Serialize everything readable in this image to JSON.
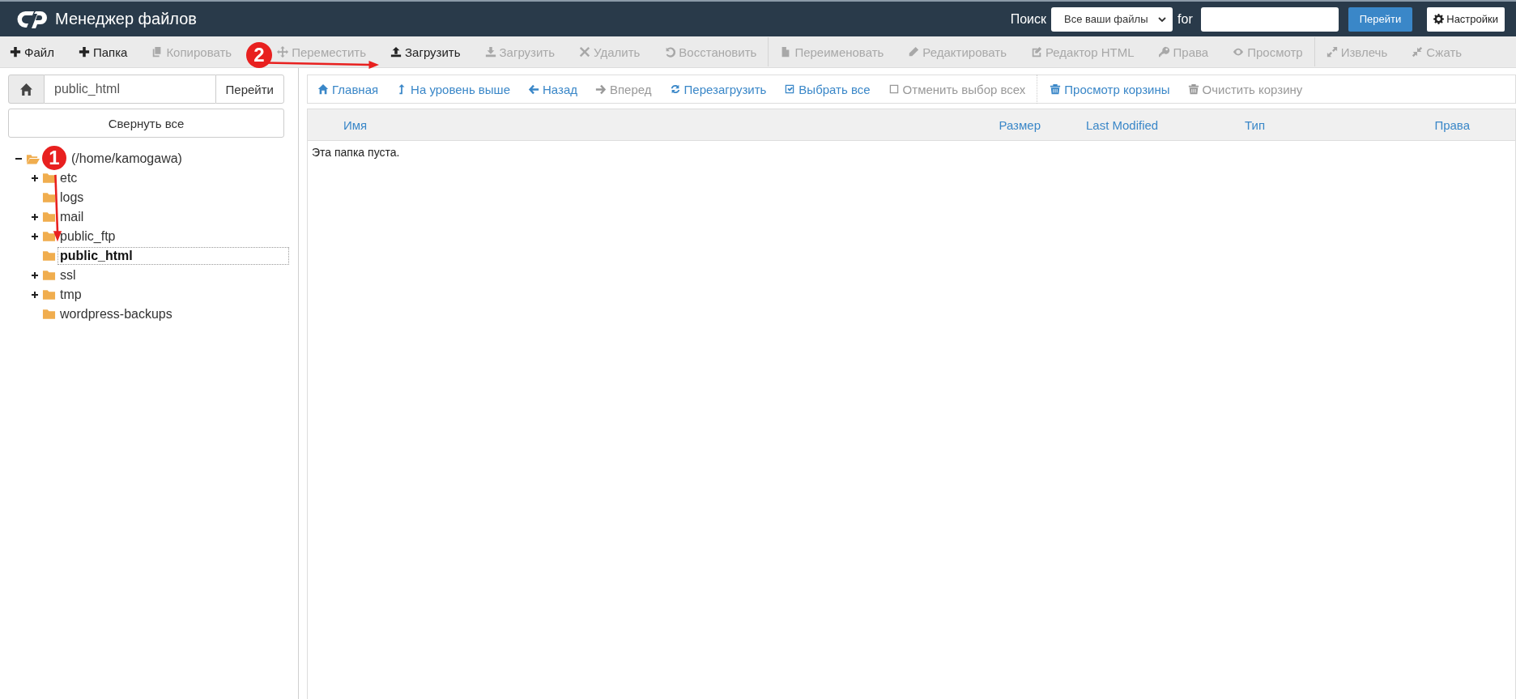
{
  "header": {
    "title": "Менеджер файлов",
    "search_label": "Поиск",
    "search_scope": "Все ваши файлы",
    "for_label": "for",
    "go_button": "Перейти",
    "settings_button": "Настройки"
  },
  "toolbar": [
    {
      "label": "Файл",
      "disabled": false
    },
    {
      "label": "Папка",
      "disabled": false
    },
    {
      "label": "Копировать",
      "disabled": true
    },
    {
      "label": "Переместить",
      "disabled": true
    },
    {
      "label": "Загрузить",
      "disabled": false
    },
    {
      "label": "Загрузить",
      "disabled": true
    },
    {
      "label": "Удалить",
      "disabled": true
    },
    {
      "label": "Восстановить",
      "disabled": true
    },
    {
      "label": "Переименовать",
      "disabled": true
    },
    {
      "label": "Редактировать",
      "disabled": true
    },
    {
      "label": "Редактор HTML",
      "disabled": true
    },
    {
      "label": "Права",
      "disabled": true
    },
    {
      "label": "Просмотр",
      "disabled": true
    },
    {
      "label": "Извлечь",
      "disabled": true
    },
    {
      "label": "Сжать",
      "disabled": true
    }
  ],
  "sidebar": {
    "path_value": "public_html",
    "go_button": "Перейти",
    "collapse_button": "Свернуть все",
    "tree": {
      "label": "(/home/kamogawa)",
      "expanded": true,
      "children": [
        {
          "label": "etc",
          "has_children": true,
          "selected": false
        },
        {
          "label": "logs",
          "has_children": false,
          "selected": false
        },
        {
          "label": "mail",
          "has_children": true,
          "selected": false
        },
        {
          "label": "public_ftp",
          "has_children": true,
          "selected": false
        },
        {
          "label": "public_html",
          "has_children": false,
          "selected": true
        },
        {
          "label": "ssl",
          "has_children": true,
          "selected": false
        },
        {
          "label": "tmp",
          "has_children": true,
          "selected": false
        },
        {
          "label": "wordpress-backups",
          "has_children": false,
          "selected": false
        }
      ]
    }
  },
  "nav": [
    {
      "label": "Главная",
      "disabled": false
    },
    {
      "label": "На уровень выше",
      "disabled": false
    },
    {
      "label": "Назад",
      "disabled": false
    },
    {
      "label": "Вперед",
      "disabled": true
    },
    {
      "label": "Перезагрузить",
      "disabled": false
    },
    {
      "label": "Выбрать все",
      "disabled": false
    },
    {
      "label": "Отменить выбор всех",
      "disabled": true
    },
    {
      "label": "Просмотр корзины",
      "disabled": false
    },
    {
      "label": "Очистить корзину",
      "disabled": true
    }
  ],
  "table": {
    "columns": [
      "Имя",
      "Размер",
      "Last Modified",
      "Тип",
      "Права"
    ],
    "empty_message": "Эта папка пуста."
  },
  "annotations": [
    {
      "number": "2"
    },
    {
      "number": "1"
    }
  ]
}
